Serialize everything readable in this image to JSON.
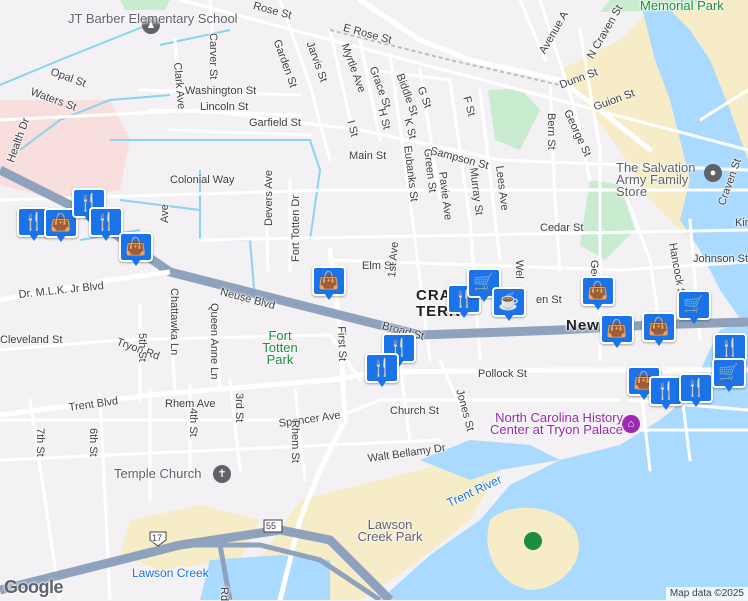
{
  "map": {
    "attribution": "Map data ©2025",
    "logo": "Google",
    "colors": {
      "land": "#f3f1f4",
      "water": "#aadaff",
      "road": "#ffffff",
      "highway": "#8fa2bd",
      "park": "#c9ecd0",
      "sand": "#f6ecc8",
      "hospital": "#f9dede",
      "stream": "#8ad3f1",
      "marker": "#1a73e8"
    },
    "streets": [
      "JT Barber Elementary School",
      "Rose St",
      "E Rose St",
      "Garden St",
      "Jarvis St",
      "Myrtle Ave",
      "Grace St",
      "Biddle St",
      "G St",
      "Carver St",
      "Clark Ave",
      "Washington St",
      "Lincoln St",
      "Garfield St",
      "Opal St",
      "Waters St",
      "Health Dr",
      "Colonial Way",
      "Devers Ave",
      "Fort Totten Dr",
      "Main St",
      "I St",
      "H St",
      "K St",
      "F St",
      "Sampson St",
      "Eubanks St",
      "Green St",
      "Pavie Ave",
      "Murray St",
      "Lees Ave",
      "Bern St",
      "George St",
      "Avenue A",
      "N Craven St",
      "Dunn St",
      "Guion St",
      "Cedar St",
      "Elm St",
      "1st Ave",
      "Dr. M.L.K. Jr Blvd",
      "Neuse Blvd",
      "Broad St",
      "Johnson St",
      "Craven St",
      "Hancock St",
      "Tryon Rd",
      "Chattawka Ln",
      "Queen Anne Ln",
      "5th St",
      "3rd St",
      "4th St",
      "6th St",
      "7th St",
      "Rhem Ave",
      "Spencer Ave",
      "Trent Blvd",
      "Pollock St",
      "Church St",
      "Jones St",
      "Walt Bellamy Dr",
      "Rhem St",
      "First St",
      "Cleveland St",
      "Lawson Creek",
      "Rd",
      "Ave",
      "Gec",
      "Kin",
      "Wel",
      "en St",
      "CRA",
      "TERR",
      "New"
    ],
    "places": [
      "Memorial Park",
      "Fort Totten Park",
      "Temple Church",
      "Lawson Creek Park",
      "Trent River",
      "The Salvation Army Family Store",
      "North Carolina History Center at Tryon Palace"
    ],
    "highway_shields": [
      "17",
      "55"
    ],
    "markers": [
      {
        "icon": "restaurant-icon"
      },
      {
        "icon": "shopping-bag-icon"
      },
      {
        "icon": "restaurant-icon"
      },
      {
        "icon": "restaurant-icon"
      },
      {
        "icon": "shopping-bag-icon"
      },
      {
        "icon": "shopping-bag-icon"
      },
      {
        "icon": "restaurant-icon"
      },
      {
        "icon": "grocery-cart-icon"
      },
      {
        "icon": "coffee-cup-icon"
      },
      {
        "icon": "restaurant-icon"
      },
      {
        "icon": "restaurant-icon"
      },
      {
        "icon": "shopping-bag-icon"
      },
      {
        "icon": "shopping-bag-icon"
      },
      {
        "icon": "shopping-bag-icon"
      },
      {
        "icon": "grocery-cart-icon"
      },
      {
        "icon": "restaurant-icon"
      },
      {
        "icon": "shopping-bag-icon"
      },
      {
        "icon": "restaurant-icon"
      },
      {
        "icon": "restaurant-icon"
      },
      {
        "icon": "grocery-cart-icon"
      }
    ]
  }
}
